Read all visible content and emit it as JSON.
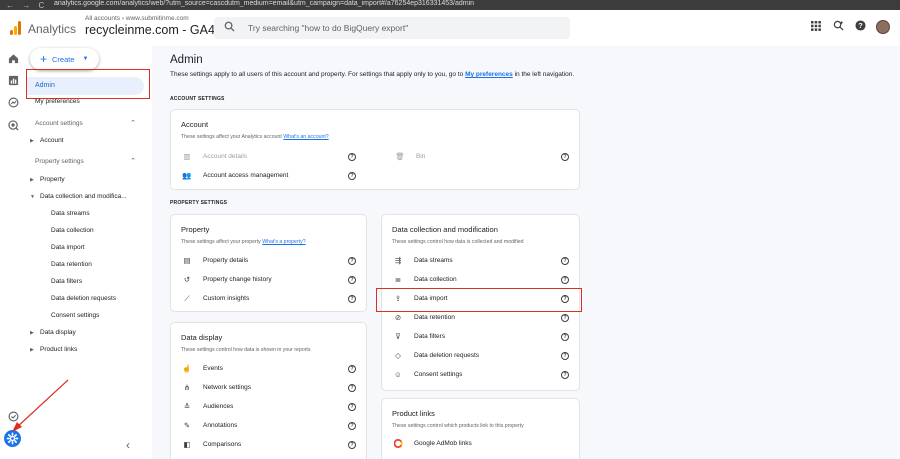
{
  "browser": {
    "nav_glyphs": "← → C",
    "url": "analytics.google.com/analytics/web/?utm_source=cascdutm_medium=email&utm_campaign=data_import#/a76254ep316331453/admin"
  },
  "header": {
    "app_name": "Analytics",
    "breadcrumb_small": "All accounts › www.submitinme.com",
    "property_name": "recycleinme.com - GA4",
    "search_placeholder": "Try searching \"how to do BigQuery export\""
  },
  "sidebar": {
    "create_label": "Create",
    "admin_label": "Admin",
    "my_preferences_label": "My preferences",
    "account_settings_label": "Account settings",
    "account_label": "Account",
    "property_settings_label": "Property settings",
    "property_label": "Property",
    "data_collection_label": "Data collection and modifica...",
    "sub_items": [
      "Data streams",
      "Data collection",
      "Data import",
      "Data retention",
      "Data filters",
      "Data deletion requests",
      "Consent settings"
    ],
    "data_display_label": "Data display",
    "product_links_label": "Product links"
  },
  "main": {
    "title": "Admin",
    "desc_prefix": "These settings apply to all users of this account and property. For settings that apply only to you, go to ",
    "desc_link": "My preferences",
    "desc_suffix": " in the left navigation.",
    "account_settings_heading": "ACCOUNT SETTINGS",
    "property_settings_heading": "PROPERTY SETTINGS",
    "account_card": {
      "title": "Account",
      "sub_prefix": "These settings affect your Analytics account ",
      "sub_link": "What's an account?",
      "rows": [
        {
          "label": "Account details",
          "icon": "building-icon"
        },
        {
          "label": "Bin",
          "icon": "trash-icon"
        },
        {
          "label": "Account access management",
          "icon": "people-icon"
        }
      ]
    },
    "property_card": {
      "title": "Property",
      "sub_prefix": "These settings affect your property ",
      "sub_link": "What's a property?",
      "rows": [
        {
          "label": "Property details",
          "icon": "details-icon"
        },
        {
          "label": "Property change history",
          "icon": "history-icon"
        },
        {
          "label": "Custom insights",
          "icon": "insights-icon"
        }
      ]
    },
    "data_display_card": {
      "title": "Data display",
      "sub": "These settings control how data is shown in your reports",
      "rows": [
        {
          "label": "Events",
          "icon": "touch-icon"
        },
        {
          "label": "Network settings",
          "icon": "network-icon"
        },
        {
          "label": "Audiences",
          "icon": "audience-icon"
        },
        {
          "label": "Annotations",
          "icon": "annotation-icon"
        },
        {
          "label": "Comparisons",
          "icon": "compare-icon"
        }
      ]
    },
    "data_collection_card": {
      "title": "Data collection and modification",
      "sub": "These settings control how data is collected and modified",
      "rows": [
        {
          "label": "Data streams",
          "icon": "streams-icon"
        },
        {
          "label": "Data collection",
          "icon": "database-icon"
        },
        {
          "label": "Data import",
          "icon": "upload-icon"
        },
        {
          "label": "Data retention",
          "icon": "retention-icon"
        },
        {
          "label": "Data filters",
          "icon": "filter-icon"
        },
        {
          "label": "Data deletion requests",
          "icon": "eraser-icon"
        },
        {
          "label": "Consent settings",
          "icon": "consent-icon"
        }
      ]
    },
    "product_links_card": {
      "title": "Product links",
      "sub": "These settings control which products link to this property",
      "rows": [
        {
          "label": "Google AdMob links",
          "icon": "admob-icon"
        }
      ]
    }
  },
  "colors": {
    "accent": "#1a73e8",
    "highlight": "#d93025",
    "main_bg": "#f6f8fc"
  }
}
